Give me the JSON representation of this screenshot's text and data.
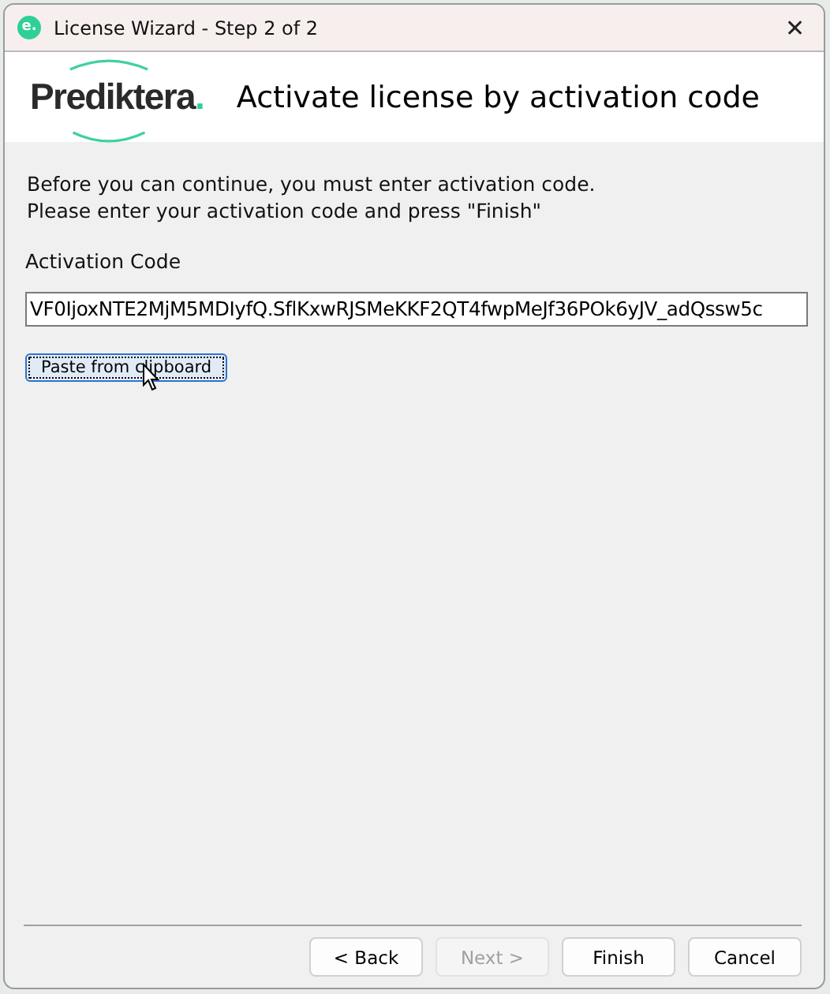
{
  "window": {
    "app_icon_text": "e.",
    "title": "License Wizard - Step 2 of 2",
    "close": "✕"
  },
  "header": {
    "logo": {
      "text": "Prediktera",
      "mark": "."
    },
    "heading": "Activate license by activation code"
  },
  "instructions": [
    "Before you can continue, you must enter activation code.",
    "Please enter your activation code and press \"Finish\""
  ],
  "activation_code": {
    "label": "Activation Code",
    "value": "VF0IjoxNTE2MjM5MDIyfQ.SflKxwRJSMeKKF2QT4fwpMeJf36POk6yJV_adQssw5c"
  },
  "paste_button": {
    "label": "Paste from clipboard",
    "focused": true
  },
  "buttons": [
    {
      "label": "< Back",
      "disabled": false
    },
    {
      "label": "Next >",
      "disabled": true
    },
    {
      "label": "Finish",
      "disabled": false
    },
    {
      "label": "Cancel",
      "disabled": false
    }
  ]
}
